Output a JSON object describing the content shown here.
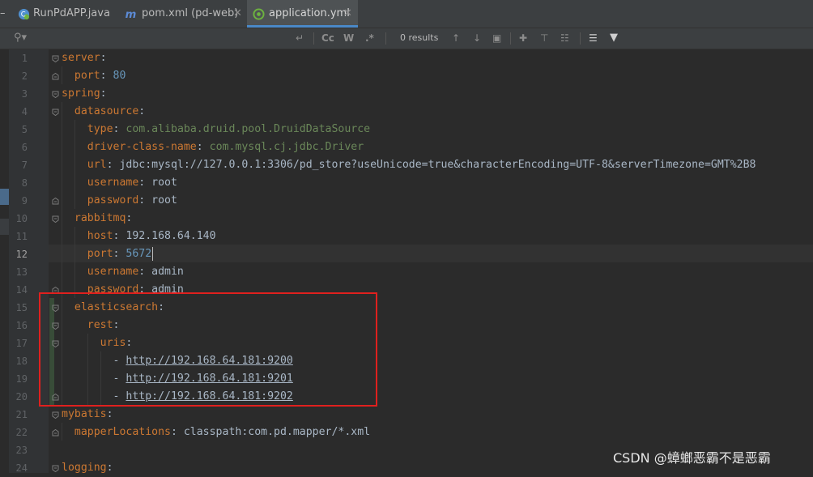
{
  "tabs": [
    {
      "label": "RunPdAPP.java",
      "icon": "spring-boot-icon",
      "active": false
    },
    {
      "label": "pom.xml (pd-web)",
      "icon": "maven-icon",
      "active": false
    },
    {
      "label": "application.yml",
      "icon": "spring-config-icon",
      "active": true
    }
  ],
  "find": {
    "placeholder": "",
    "match_case": "Cc",
    "words": "W",
    "regex": ".*",
    "results": "0 results"
  },
  "editor": {
    "current_line": 12,
    "lines": [
      {
        "no": "1",
        "tokens": [
          {
            "t": "k",
            "v": "server"
          },
          {
            "t": "t",
            "v": ":"
          }
        ]
      },
      {
        "no": "2",
        "tokens": [
          {
            "t": "t",
            "v": "  "
          },
          {
            "t": "k",
            "v": "port"
          },
          {
            "t": "t",
            "v": ": "
          },
          {
            "t": "n",
            "v": "80"
          }
        ]
      },
      {
        "no": "3",
        "tokens": [
          {
            "t": "k",
            "v": "spring"
          },
          {
            "t": "t",
            "v": ":"
          }
        ]
      },
      {
        "no": "4",
        "tokens": [
          {
            "t": "t",
            "v": "  "
          },
          {
            "t": "k",
            "v": "datasource"
          },
          {
            "t": "t",
            "v": ":"
          }
        ]
      },
      {
        "no": "5",
        "tokens": [
          {
            "t": "t",
            "v": "    "
          },
          {
            "t": "k",
            "v": "type"
          },
          {
            "t": "t",
            "v": ": "
          },
          {
            "t": "s",
            "v": "com.alibaba.druid.pool.DruidDataSource"
          }
        ]
      },
      {
        "no": "6",
        "tokens": [
          {
            "t": "t",
            "v": "    "
          },
          {
            "t": "k",
            "v": "driver-class-name"
          },
          {
            "t": "t",
            "v": ": "
          },
          {
            "t": "s",
            "v": "com.mysql.cj.jdbc.Driver"
          }
        ]
      },
      {
        "no": "7",
        "tokens": [
          {
            "t": "t",
            "v": "    "
          },
          {
            "t": "k",
            "v": "url"
          },
          {
            "t": "t",
            "v": ": jdbc:mysql://127.0.0.1:3306/pd_store?useUnicode=true&characterEncoding=UTF-8&serverTimezone=GMT%2B8"
          }
        ]
      },
      {
        "no": "8",
        "tokens": [
          {
            "t": "t",
            "v": "    "
          },
          {
            "t": "k",
            "v": "username"
          },
          {
            "t": "t",
            "v": ": root"
          }
        ]
      },
      {
        "no": "9",
        "tokens": [
          {
            "t": "t",
            "v": "    "
          },
          {
            "t": "k",
            "v": "password"
          },
          {
            "t": "t",
            "v": ": root"
          }
        ]
      },
      {
        "no": "10",
        "tokens": [
          {
            "t": "t",
            "v": "  "
          },
          {
            "t": "k",
            "v": "rabbitmq"
          },
          {
            "t": "t",
            "v": ":"
          }
        ]
      },
      {
        "no": "11",
        "tokens": [
          {
            "t": "t",
            "v": "    "
          },
          {
            "t": "k",
            "v": "host"
          },
          {
            "t": "t",
            "v": ": 192.168.64.140"
          }
        ]
      },
      {
        "no": "12",
        "tokens": [
          {
            "t": "t",
            "v": "    "
          },
          {
            "t": "k",
            "v": "port"
          },
          {
            "t": "t",
            "v": ": "
          },
          {
            "t": "n",
            "v": "5672"
          }
        ]
      },
      {
        "no": "13",
        "tokens": [
          {
            "t": "t",
            "v": "    "
          },
          {
            "t": "k",
            "v": "username"
          },
          {
            "t": "t",
            "v": ": admin"
          }
        ]
      },
      {
        "no": "14",
        "tokens": [
          {
            "t": "t",
            "v": "    "
          },
          {
            "t": "k",
            "v": "password"
          },
          {
            "t": "t",
            "v": ": admin"
          }
        ]
      },
      {
        "no": "15",
        "tokens": [
          {
            "t": "t",
            "v": "  "
          },
          {
            "t": "k",
            "v": "elasticsearch"
          },
          {
            "t": "t",
            "v": ":"
          }
        ]
      },
      {
        "no": "16",
        "tokens": [
          {
            "t": "t",
            "v": "    "
          },
          {
            "t": "k",
            "v": "rest"
          },
          {
            "t": "t",
            "v": ":"
          }
        ]
      },
      {
        "no": "17",
        "tokens": [
          {
            "t": "t",
            "v": "      "
          },
          {
            "t": "k",
            "v": "uris"
          },
          {
            "t": "t",
            "v": ":"
          }
        ]
      },
      {
        "no": "18",
        "tokens": [
          {
            "t": "t",
            "v": "        - "
          },
          {
            "t": "u",
            "v": "http://192.168.64.181:9200"
          }
        ]
      },
      {
        "no": "19",
        "tokens": [
          {
            "t": "t",
            "v": "        - "
          },
          {
            "t": "u",
            "v": "http://192.168.64.181:9201"
          }
        ]
      },
      {
        "no": "20",
        "tokens": [
          {
            "t": "t",
            "v": "        - "
          },
          {
            "t": "u",
            "v": "http://192.168.64.181:9202"
          }
        ]
      },
      {
        "no": "21",
        "tokens": [
          {
            "t": "k",
            "v": "mybatis"
          },
          {
            "t": "t",
            "v": ":"
          }
        ]
      },
      {
        "no": "22",
        "tokens": [
          {
            "t": "t",
            "v": "  "
          },
          {
            "t": "k",
            "v": "mapperLocations"
          },
          {
            "t": "t",
            "v": ": classpath:com.pd.mapper/*.xml"
          }
        ]
      },
      {
        "no": "23",
        "tokens": []
      },
      {
        "no": "24",
        "tokens": [
          {
            "t": "k",
            "v": "logging"
          },
          {
            "t": "t",
            "v": ":"
          }
        ]
      }
    ]
  },
  "watermark": "CSDN @蟑螂恶霸不是恶霸",
  "colors": {
    "key": "#cc7832",
    "number": "#6897bb",
    "string": "#6a8759",
    "text": "#a9b7c6",
    "highlight_box": "#e0201e"
  }
}
